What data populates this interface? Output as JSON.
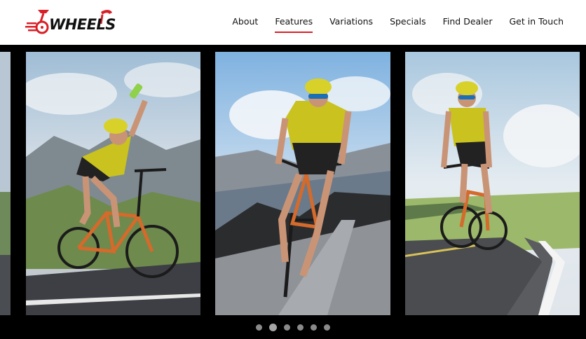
{
  "brand": {
    "name": "WHEELS",
    "accent_color": "#d91f26"
  },
  "nav": {
    "items": [
      {
        "label": "About",
        "active": false
      },
      {
        "label": "Features",
        "active": true
      },
      {
        "label": "Variations",
        "active": false
      },
      {
        "label": "Specials",
        "active": false
      },
      {
        "label": "Find Dealer",
        "active": false
      },
      {
        "label": "Get in Touch",
        "active": false
      }
    ]
  },
  "carousel": {
    "slides": [
      {
        "image": "cyclist-drinking-photo"
      },
      {
        "image": "cyclist-sprinting-photo"
      },
      {
        "image": "cyclist-riding-road-photo"
      }
    ],
    "dots_count": 6,
    "active_dot": 2
  }
}
